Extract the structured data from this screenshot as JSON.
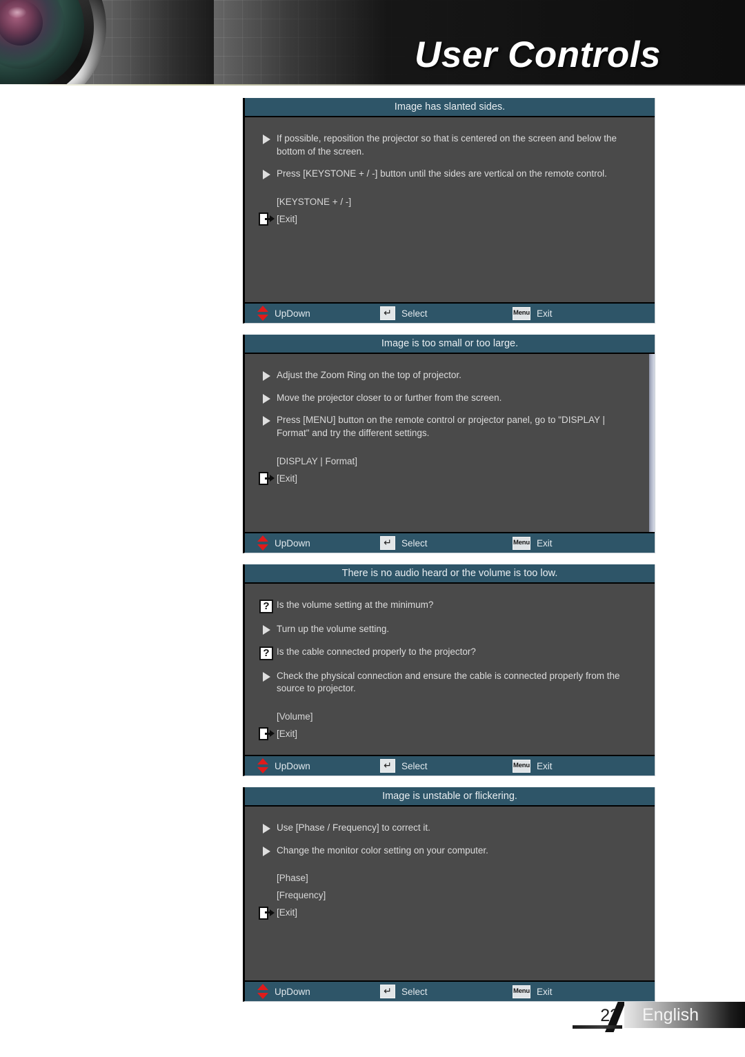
{
  "header": {
    "title": "User Controls",
    "lens_icon": "projector-lens-icon"
  },
  "panels": [
    {
      "title": "Image has slanted sides.",
      "tips": [
        {
          "icon": "triangle-bullet-icon",
          "text": "If possible, reposition the projector so that is centered on the screen and below the bottom of the screen."
        },
        {
          "icon": "triangle-bullet-icon",
          "text": "Press [KEYSTONE + / -] button until the sides are vertical on the remote control."
        }
      ],
      "refs": [
        {
          "icon": "none",
          "label": "[KEYSTONE + / -]"
        },
        {
          "icon": "exit-door-icon",
          "label": "[Exit]"
        }
      ],
      "body_min_height": "268",
      "footer": {
        "updown_label": "UpDown",
        "select_label": "Select",
        "exit_label": "Exit",
        "select_icon": "enter-key-icon",
        "menu_icon": "menu-key-icon",
        "menu_key_text": "Menu",
        "updown_icon": "up-down-arrow-icon",
        "enter_glyph": "↵"
      }
    },
    {
      "title": "Image is too small or too large.",
      "tips": [
        {
          "icon": "triangle-bullet-icon",
          "text": "Adjust the Zoom Ring on the top of projector."
        },
        {
          "icon": "triangle-bullet-icon",
          "text": "Move the projector closer to or further from the screen."
        },
        {
          "icon": "triangle-bullet-icon",
          "text": "Press [MENU] button on the remote control or projector panel, go to \"DISPLAY | Format\" and try the different settings."
        }
      ],
      "refs": [
        {
          "icon": "none",
          "label": "[DISPLAY | Format]"
        },
        {
          "icon": "exit-door-icon",
          "label": "[Exit]"
        }
      ],
      "body_min_height": "258",
      "has_scrollbar": true,
      "footer": {
        "updown_label": "UpDown",
        "select_label": "Select",
        "exit_label": "Exit",
        "select_icon": "enter-key-icon",
        "menu_icon": "menu-key-icon",
        "menu_key_text": "Menu",
        "updown_icon": "up-down-arrow-icon",
        "enter_glyph": "↵"
      }
    },
    {
      "title": "There is no audio heard or the volume is too low.",
      "tips": [
        {
          "icon": "question-box-icon",
          "text": "Is the volume setting at the minimum?"
        },
        {
          "icon": "triangle-bullet-icon",
          "text": "Turn up the volume setting."
        },
        {
          "icon": "question-box-icon",
          "text": "Is the cable connected properly to the projector?"
        },
        {
          "icon": "triangle-bullet-icon",
          "text": "Check the physical connection and ensure the cable is connected properly from the source to projector."
        }
      ],
      "refs": [
        {
          "icon": "none",
          "label": "[Volume]"
        },
        {
          "icon": "exit-door-icon",
          "label": "[Exit]"
        }
      ],
      "body_min_height": "248",
      "footer": {
        "updown_label": "UpDown",
        "select_label": "Select",
        "exit_label": "Exit",
        "select_icon": "enter-key-icon",
        "menu_icon": "menu-key-icon",
        "menu_key_text": "Menu",
        "updown_icon": "up-down-arrow-icon",
        "enter_glyph": "↵"
      }
    },
    {
      "title": "Image is unstable or flickering.",
      "tips": [
        {
          "icon": "triangle-bullet-icon",
          "text": "Use [Phase / Frequency] to correct it."
        },
        {
          "icon": "triangle-bullet-icon",
          "text": "Change the monitor color setting on your computer."
        }
      ],
      "refs": [
        {
          "icon": "none",
          "label": "[Phase]"
        },
        {
          "icon": "none",
          "label": "[Frequency]"
        },
        {
          "icon": "exit-door-icon",
          "label": "[Exit]"
        }
      ],
      "body_min_height": "252",
      "footer": {
        "updown_label": "UpDown",
        "select_label": "Select",
        "exit_label": "Exit",
        "select_icon": "enter-key-icon",
        "menu_icon": "menu-key-icon",
        "menu_key_text": "Menu",
        "updown_icon": "up-down-arrow-icon",
        "enter_glyph": "↵"
      }
    }
  ],
  "footer": {
    "page_number": "23",
    "language": "English"
  },
  "colors": {
    "osd_title_bar": "#2e5568",
    "osd_body": "#4a4a4a",
    "osd_text": "#dcdcdc",
    "accent_red": "#e01b1b",
    "header_dark": "#141414"
  }
}
